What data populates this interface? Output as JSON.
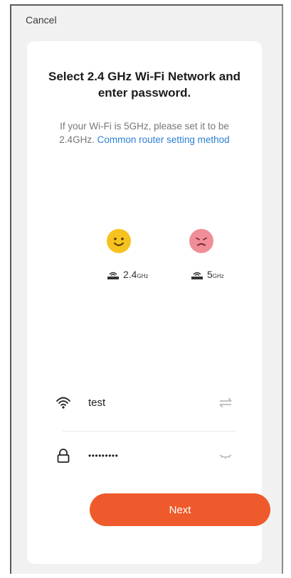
{
  "header": {
    "cancel_label": "Cancel"
  },
  "card": {
    "title": "Select 2.4 GHz Wi-Fi Network and enter password.",
    "subtitle_text": "If your Wi-Fi is 5GHz, please set it to be 2.4GHz.",
    "subtitle_link": "Common router setting method"
  },
  "bands": {
    "good": {
      "label": "2.4",
      "unit": "GHz",
      "icon": "smile-face-icon"
    },
    "bad": {
      "label": "5",
      "unit": "GHz",
      "icon": "sad-face-icon"
    }
  },
  "form": {
    "wifi_name": "test",
    "password_masked": "•••••••••"
  },
  "actions": {
    "next_label": "Next"
  },
  "colors": {
    "accent": "#ee5a2b",
    "link": "#2d7fd3",
    "good_face": "#f6c21f",
    "bad_face": "#f08e97"
  }
}
